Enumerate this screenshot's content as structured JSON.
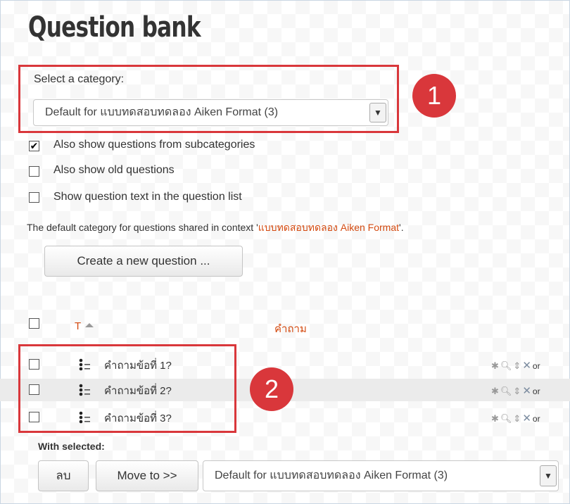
{
  "page": {
    "title": "Question bank"
  },
  "category": {
    "label": "Select a category:",
    "selected": "Default for แบบทดสอบทดลอง Aiken Format (3)"
  },
  "options": [
    {
      "label": "Also show questions from subcategories",
      "checked": true
    },
    {
      "label": "Also show old questions",
      "checked": false
    },
    {
      "label": "Show question text in the question list",
      "checked": false
    }
  ],
  "info": {
    "prefix": "The default category for questions shared in context '",
    "context": "แบบทดสอบทดลอง Aiken Format",
    "suffix": "'."
  },
  "create_button": "Create a new question ...",
  "table": {
    "col_type": "T",
    "col_question": "คำถาม",
    "rows": [
      {
        "name": "คำถามข้อที่ 1?",
        "owner": "or"
      },
      {
        "name": "คำถามข้อที่ 2?",
        "owner": "or"
      },
      {
        "name": "คำถามข้อที่ 3?",
        "owner": "or"
      }
    ]
  },
  "markers": {
    "one": "1",
    "two": "2"
  },
  "bulk": {
    "label": "With selected:",
    "delete": "ลบ",
    "move": "Move to >>",
    "target": "Default for แบบทดสอบทดลอง Aiken Format (3)"
  },
  "colors": {
    "accent_red": "#d9373b",
    "link": "#d44a10"
  }
}
